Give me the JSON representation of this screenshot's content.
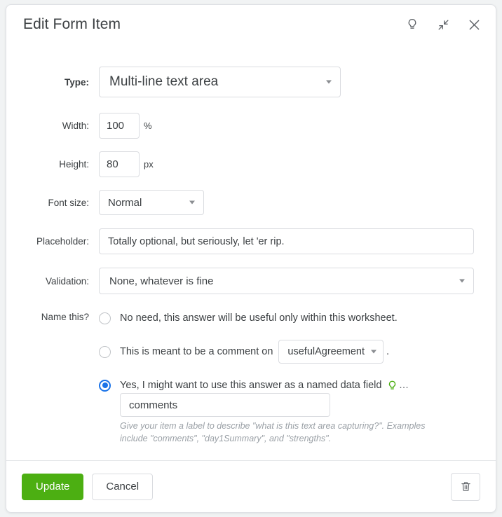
{
  "header": {
    "title": "Edit Form Item",
    "icons": {
      "hint": "lightbulb-icon",
      "collapse": "shrink-icon",
      "close": "close-icon"
    }
  },
  "form": {
    "type": {
      "label": "Type:",
      "value": "Multi-line text area"
    },
    "width": {
      "label": "Width:",
      "value": "100",
      "unit": "%"
    },
    "height": {
      "label": "Height:",
      "value": "80",
      "unit": "px"
    },
    "font_size": {
      "label": "Font size:",
      "value": "Normal"
    },
    "placeholder": {
      "label": "Placeholder:",
      "value": "Totally optional, but seriously, let 'er rip.",
      "placeholder": ""
    },
    "validation": {
      "label": "Validation:",
      "value": "None, whatever is fine"
    },
    "name_this": {
      "label": "Name this?",
      "options": [
        {
          "id": "no-need",
          "text": "No need, this answer will be useful only within this worksheet.",
          "selected": false
        },
        {
          "id": "comment-on",
          "text": "This is meant to be a comment on",
          "dropdown_value": "usefulAgreement",
          "trailing": ".",
          "selected": false
        },
        {
          "id": "named-field",
          "text": "Yes, I might want to use this answer as a named data field",
          "hint_icon": "lightbulb-icon-green",
          "ellipsis": "...",
          "selected": true
        }
      ],
      "name_input": {
        "value": "comments",
        "placeholder": ""
      },
      "help_text": "Give your item a label to describe \"what is this text area capturing?\". Examples include \"comments\", \"day1Summary\", and \"strengths\"."
    }
  },
  "footer": {
    "update_label": "Update",
    "cancel_label": "Cancel",
    "delete_icon": "trash-icon"
  },
  "colors": {
    "primary_green": "#4caf12",
    "radio_blue": "#1a73e8",
    "hint_green": "#4caf12",
    "border": "#dadce0",
    "text": "#3c4043",
    "muted": "#9aa0a6"
  }
}
